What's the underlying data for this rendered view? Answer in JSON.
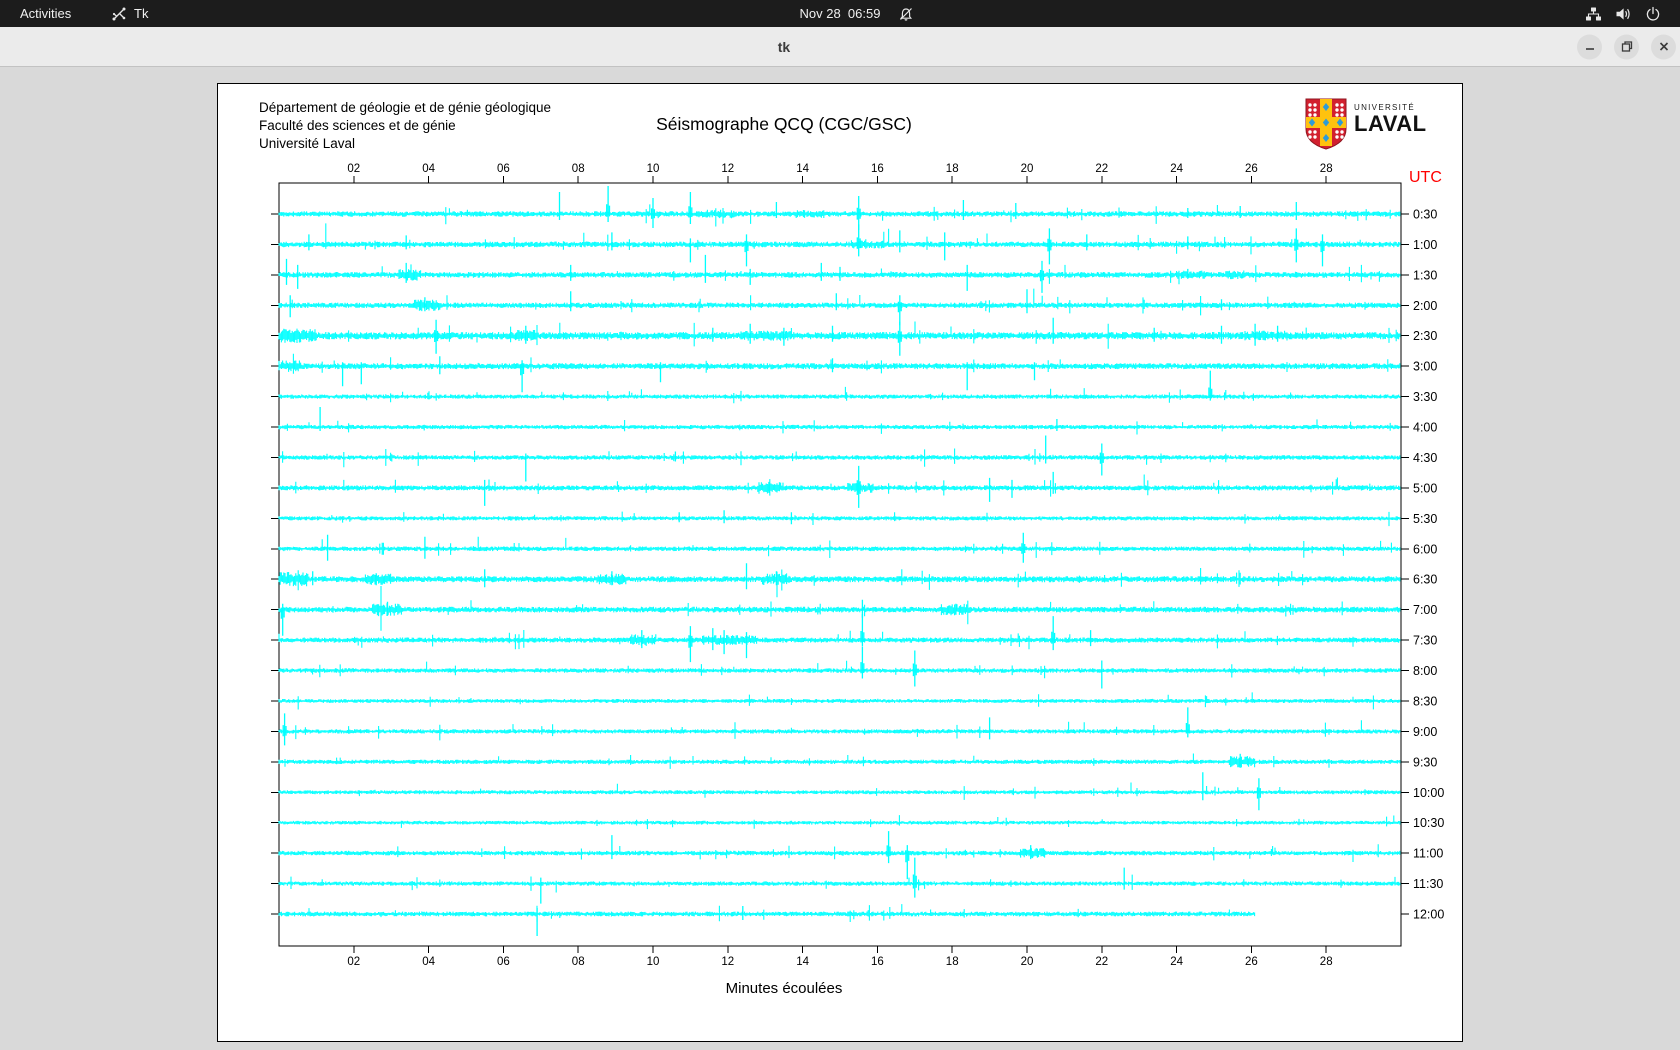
{
  "topbar": {
    "activities_label": "Activities",
    "app_menu_label": "Tk",
    "clock": "Nov 28  06:59",
    "bell_icon": "notifications-disabled",
    "status_icons": [
      "wired-network",
      "volume",
      "power"
    ]
  },
  "window": {
    "title": "tk",
    "controls": [
      "minimize",
      "maximize",
      "close"
    ]
  },
  "seismograph": {
    "org_lines": [
      "Département de géologie et de génie géologique",
      "Faculté des sciences et de génie",
      "Université Laval"
    ],
    "title": "Séismographe QCQ (CGC/GSC)",
    "logo": {
      "top": "UNIVERSITÉ",
      "bottom": "LAVAL"
    },
    "utc_label": "UTC",
    "xlabel": "Minutes écoulées",
    "colors": {
      "trace": "#00ffff",
      "utc": "#ff0000",
      "axis": "#000000",
      "shield_red": "#d2202f",
      "shield_gold": "#ffc20e",
      "shield_blue": "#2e9bd6"
    },
    "chart_data": {
      "type": "seismograph",
      "x_axis": {
        "label": "Minutes écoulées",
        "range": [
          0,
          30
        ],
        "ticks": [
          "02",
          "04",
          "06",
          "08",
          "10",
          "12",
          "14",
          "16",
          "18",
          "20",
          "22",
          "24",
          "26",
          "28"
        ]
      },
      "y_axis": {
        "label": "UTC",
        "tick_interval": "30 min"
      },
      "rows": [
        {
          "label": "0:30",
          "noise": 1.9,
          "events": [
            [
              7.5,
              22,
              6
            ],
            [
              8.8,
              28,
              8
            ],
            [
              10,
              16,
              14
            ],
            [
              11,
              22,
              10
            ],
            [
              13.3,
              12,
              4
            ],
            [
              15.5,
              18,
              16
            ],
            [
              18.3,
              14,
              6
            ],
            [
              19.7,
              11,
              5
            ],
            [
              24.3,
              6,
              4
            ],
            [
              25.7,
              8,
              4
            ],
            [
              27.2,
              12,
              6
            ]
          ],
          "bursts": [
            [
              11.2,
              12.2,
              3
            ],
            [
              13.8,
              14.6,
              3
            ]
          ]
        },
        {
          "label": "1:00",
          "noise": 2.0,
          "events": [
            [
              0.8,
              10,
              6
            ],
            [
              3.4,
              9,
              5
            ],
            [
              8.9,
              12,
              6
            ],
            [
              11,
              6,
              18
            ],
            [
              12.5,
              10,
              22
            ],
            [
              15.5,
              20,
              12
            ],
            [
              16.6,
              14,
              8
            ],
            [
              17.8,
              12,
              16
            ],
            [
              20.6,
              16,
              20
            ],
            [
              21.6,
              10,
              6
            ],
            [
              24.3,
              8,
              5
            ],
            [
              27.2,
              16,
              18
            ],
            [
              27.9,
              10,
              22
            ]
          ],
          "bursts": [
            [
              15.3,
              16.2,
              3
            ]
          ]
        },
        {
          "label": "1:30",
          "noise": 2.0,
          "events": [
            [
              0.2,
              16,
              10
            ],
            [
              0.5,
              10,
              14
            ],
            [
              3.4,
              12,
              8
            ],
            [
              7.8,
              10,
              6
            ],
            [
              11.4,
              20,
              8
            ],
            [
              12.6,
              6,
              10
            ],
            [
              14.5,
              12,
              6
            ],
            [
              15,
              8,
              6
            ],
            [
              18.4,
              10,
              16
            ],
            [
              20.4,
              14,
              18
            ],
            [
              24.3,
              6,
              4
            ]
          ],
          "bursts": [
            [
              3.2,
              3.8,
              4
            ],
            [
              24,
              24.8,
              3
            ],
            [
              25.3,
              25.8,
              3
            ]
          ]
        },
        {
          "label": "2:00",
          "noise": 1.9,
          "events": [
            [
              0.3,
              10,
              12
            ],
            [
              3.9,
              8,
              6
            ],
            [
              7.8,
              14,
              6
            ],
            [
              14.9,
              12,
              5
            ],
            [
              16.6,
              10,
              20
            ],
            [
              20,
              16,
              8
            ],
            [
              25.2,
              6,
              5
            ]
          ],
          "bursts": [
            [
              3.6,
              4.3,
              4
            ]
          ]
        },
        {
          "label": "2:30",
          "noise": 2.6,
          "events": [
            [
              4.2,
              16,
              18
            ],
            [
              6.6,
              10,
              8
            ],
            [
              11.6,
              8,
              6
            ],
            [
              12.6,
              12,
              8
            ],
            [
              13.5,
              8,
              10
            ],
            [
              14.8,
              10,
              6
            ],
            [
              16.6,
              14,
              20
            ],
            [
              20.7,
              18,
              8
            ],
            [
              23.4,
              8,
              6
            ],
            [
              25.2,
              10,
              8
            ],
            [
              26.1,
              12,
              10
            ],
            [
              26.7,
              10,
              6
            ]
          ],
          "bursts": [
            [
              0,
              1,
              5
            ],
            [
              6.3,
              6.9,
              4
            ],
            [
              12.3,
              13.7,
              3.5
            ],
            [
              25.8,
              27,
              3.5
            ]
          ]
        },
        {
          "label": "3:00",
          "noise": 2.1,
          "events": [
            [
              1.7,
              4,
              20
            ],
            [
              2.2,
              4,
              18
            ],
            [
              4.3,
              10,
              8
            ],
            [
              6.5,
              6,
              26
            ],
            [
              10.2,
              4,
              16
            ],
            [
              14.8,
              8,
              6
            ],
            [
              18.4,
              4,
              24
            ],
            [
              20.2,
              4,
              14
            ]
          ],
          "bursts": [
            [
              0,
              0.6,
              4
            ]
          ]
        },
        {
          "label": "3:30",
          "noise": 1.5,
          "events": [
            [
              24.9,
              26,
              4
            ]
          ]
        },
        {
          "label": "4:00",
          "noise": 1.5,
          "events": [
            [
              1.1,
              20,
              4
            ],
            [
              20.8,
              8,
              4
            ]
          ]
        },
        {
          "label": "4:30",
          "noise": 1.6,
          "events": [
            [
              6.6,
              4,
              24
            ],
            [
              10.6,
              6,
              4
            ],
            [
              20.5,
              22,
              6
            ],
            [
              22,
              14,
              18
            ]
          ]
        },
        {
          "label": "5:00",
          "noise": 1.8,
          "events": [
            [
              5.5,
              8,
              18
            ],
            [
              13.1,
              6,
              5
            ],
            [
              15.5,
              22,
              20
            ],
            [
              19,
              10,
              14
            ],
            [
              19.6,
              8,
              10
            ],
            [
              20.7,
              16,
              6
            ]
          ],
          "bursts": [
            [
              12.8,
              13.5,
              4
            ],
            [
              15.2,
              15.9,
              3.5
            ]
          ]
        },
        {
          "label": "5:30",
          "noise": 1.5,
          "events": [
            [
              10.7,
              6,
              4
            ],
            [
              11.9,
              8,
              5
            ],
            [
              13.7,
              6,
              6
            ]
          ]
        },
        {
          "label": "6:00",
          "noise": 1.6,
          "events": [
            [
              1.3,
              14,
              12
            ],
            [
              3.9,
              12,
              10
            ],
            [
              19.9,
              16,
              14
            ]
          ]
        },
        {
          "label": "6:30",
          "noise": 2.1,
          "events": [
            [
              0.9,
              8,
              6
            ],
            [
              2.6,
              6,
              6
            ],
            [
              5.5,
              10,
              8
            ],
            [
              8.9,
              8,
              6
            ],
            [
              12.5,
              16,
              10
            ],
            [
              13.3,
              8,
              6
            ]
          ],
          "bursts": [
            [
              0,
              0.8,
              5
            ],
            [
              2.3,
              3,
              4
            ],
            [
              8.5,
              9.3,
              4
            ],
            [
              12.9,
              13.7,
              4
            ]
          ]
        },
        {
          "label": "7:00",
          "noise": 2.0,
          "events": [
            [
              0.1,
              6,
              26
            ],
            [
              2.9,
              8,
              6
            ],
            [
              15.6,
              10,
              8
            ],
            [
              18.1,
              6,
              5
            ]
          ],
          "bursts": [
            [
              2.5,
              3.3,
              4.5
            ],
            [
              17.7,
              18.5,
              4
            ]
          ]
        },
        {
          "label": "7:30",
          "noise": 1.8,
          "events": [
            [
              9.7,
              10,
              8
            ],
            [
              11,
              14,
              22
            ],
            [
              11.6,
              12,
              10
            ],
            [
              11.9,
              10,
              14
            ],
            [
              12.5,
              8,
              18
            ],
            [
              15.6,
              26,
              6
            ],
            [
              20.7,
              24,
              10
            ],
            [
              21.7,
              10,
              6
            ]
          ],
          "bursts": [
            [
              9.4,
              10.1,
              4
            ],
            [
              11.3,
              12.8,
              3.5
            ]
          ]
        },
        {
          "label": "8:00",
          "noise": 1.6,
          "events": [
            [
              15.6,
              24,
              8
            ],
            [
              17,
              20,
              16
            ],
            [
              22,
              10,
              18
            ]
          ]
        },
        {
          "label": "8:30",
          "noise": 1.4,
          "events": []
        },
        {
          "label": "9:00",
          "noise": 1.5,
          "events": [
            [
              0.15,
              18,
              14
            ],
            [
              19,
              14,
              8
            ],
            [
              24.3,
              24,
              6
            ]
          ]
        },
        {
          "label": "9:30",
          "noise": 1.5,
          "events": [
            [
              25.7,
              8,
              6
            ]
          ],
          "bursts": [
            [
              25.4,
              26.1,
              4
            ]
          ]
        },
        {
          "label": "10:00",
          "noise": 1.4,
          "events": [
            [
              24.7,
              20,
              8
            ],
            [
              26.2,
              14,
              18
            ]
          ]
        },
        {
          "label": "10:30",
          "noise": 1.3,
          "events": []
        },
        {
          "label": "11:00",
          "noise": 1.6,
          "events": [
            [
              8.9,
              18,
              6
            ],
            [
              16.3,
              22,
              10
            ],
            [
              16.8,
              8,
              26
            ],
            [
              20.1,
              8,
              6
            ]
          ],
          "bursts": [
            [
              19.8,
              20.5,
              3.5
            ]
          ]
        },
        {
          "label": "11:30",
          "noise": 1.5,
          "events": [
            [
              7,
              6,
              20
            ],
            [
              17,
              26,
              14
            ],
            [
              22.6,
              16,
              6
            ]
          ]
        },
        {
          "label": "12:00",
          "noise": 1.7,
          "end": 26.1,
          "events": [
            [
              6.9,
              6,
              22
            ],
            [
              12.4,
              8,
              6
            ]
          ]
        }
      ]
    }
  }
}
